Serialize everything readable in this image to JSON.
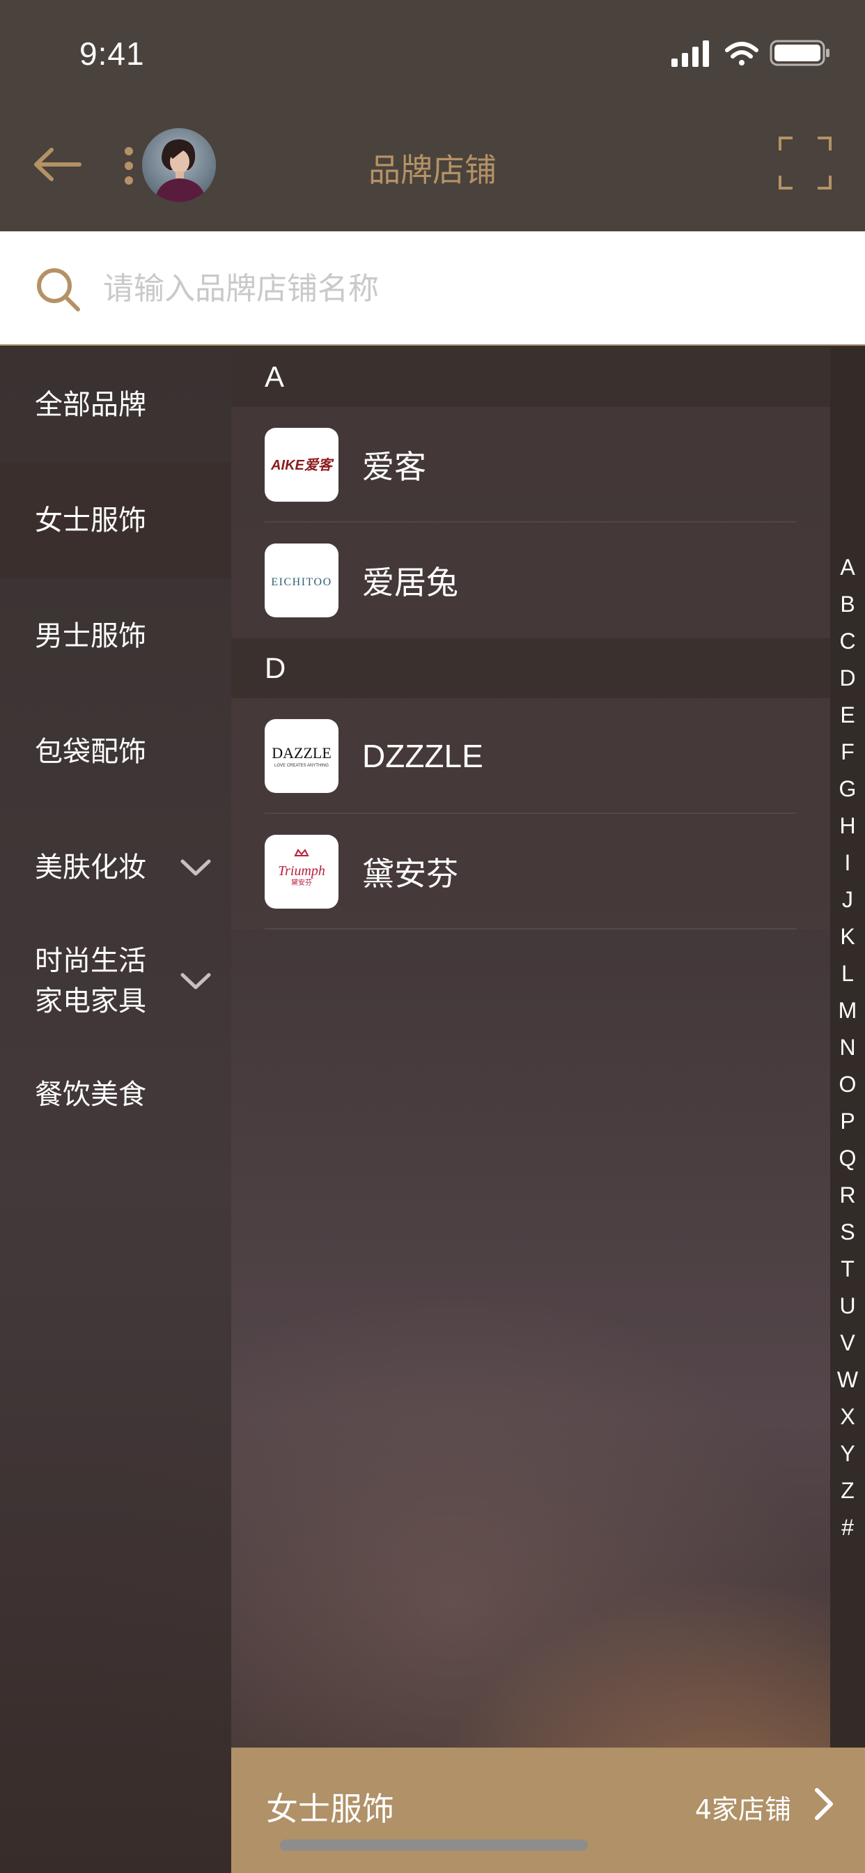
{
  "status_bar": {
    "time": "9:41"
  },
  "header": {
    "title": "品牌店铺",
    "back_icon": "arrow-left-icon",
    "more_icon": "vertical-dots-icon",
    "scan_icon": "scan-frame-icon",
    "accent_color": "#b49266"
  },
  "search": {
    "placeholder": "请输入品牌店铺名称",
    "value": "",
    "icon": "search-icon"
  },
  "categories": [
    {
      "label": "全部品牌",
      "active": false,
      "expandable": false
    },
    {
      "label": "女士服饰",
      "active": true,
      "expandable": false
    },
    {
      "label": "男士服饰",
      "active": false,
      "expandable": false
    },
    {
      "label": "包袋配饰",
      "active": false,
      "expandable": false
    },
    {
      "label": "美肤化妆",
      "active": false,
      "expandable": true
    },
    {
      "label": "时尚生活\n家电家具",
      "active": false,
      "expandable": true
    },
    {
      "label": "餐饮美食",
      "active": false,
      "expandable": false
    }
  ],
  "sections": [
    {
      "letter": "A",
      "brands": [
        {
          "name": "爱客",
          "logo_text": "AIKE爱客"
        },
        {
          "name": "爱居兔",
          "logo_text": "EICHITOO"
        }
      ]
    },
    {
      "letter": "D",
      "brands": [
        {
          "name": "DZZZLE",
          "logo_text": "DAZZLE",
          "logo_subtext": "LOVE CREATES ANYTHING"
        },
        {
          "name": "黛安芬",
          "logo_text": "Triumph",
          "logo_subtext": "黛安芬"
        }
      ]
    }
  ],
  "index_letters": [
    "A",
    "B",
    "C",
    "D",
    "E",
    "F",
    "G",
    "H",
    "I",
    "J",
    "K",
    "L",
    "M",
    "N",
    "O",
    "P",
    "Q",
    "R",
    "S",
    "T",
    "U",
    "V",
    "W",
    "X",
    "Y",
    "Z",
    "#"
  ],
  "bottom_bar": {
    "category": "女士服饰",
    "count": "4家店铺",
    "background": "#b09168"
  }
}
